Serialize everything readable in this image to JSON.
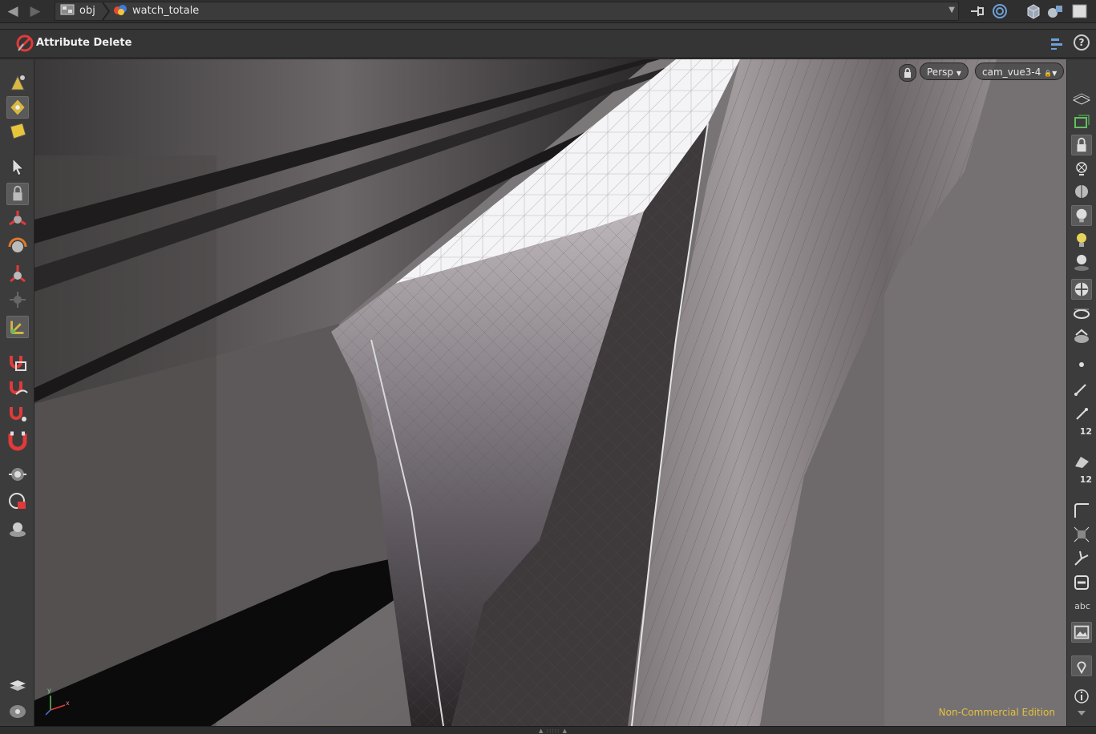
{
  "path": {
    "back_icon": "arrow-left-icon",
    "forward_icon": "arrow-right-icon",
    "crumbs": [
      {
        "label": "obj",
        "icon": "obj-network-icon"
      },
      {
        "label": "watch_totale",
        "icon": "geometry-object-icon"
      }
    ]
  },
  "operation": {
    "title": "Attribute Delete",
    "icon": "attribute-delete-icon"
  },
  "viewport": {
    "view_lock_icon": "lock-view-icon",
    "projection": "Persp",
    "camera": "cam_vue3-4",
    "edition_label": "Non-Commercial Edition",
    "axis_labels": {
      "x": "x",
      "y": "y"
    }
  },
  "right_toolbar": {
    "text_label": "abc",
    "point_number_label": "12"
  },
  "colors": {
    "accent_yellow": "#e3c23a",
    "panel": "#3c3c3c",
    "active_tool": "#5a5a5a"
  }
}
